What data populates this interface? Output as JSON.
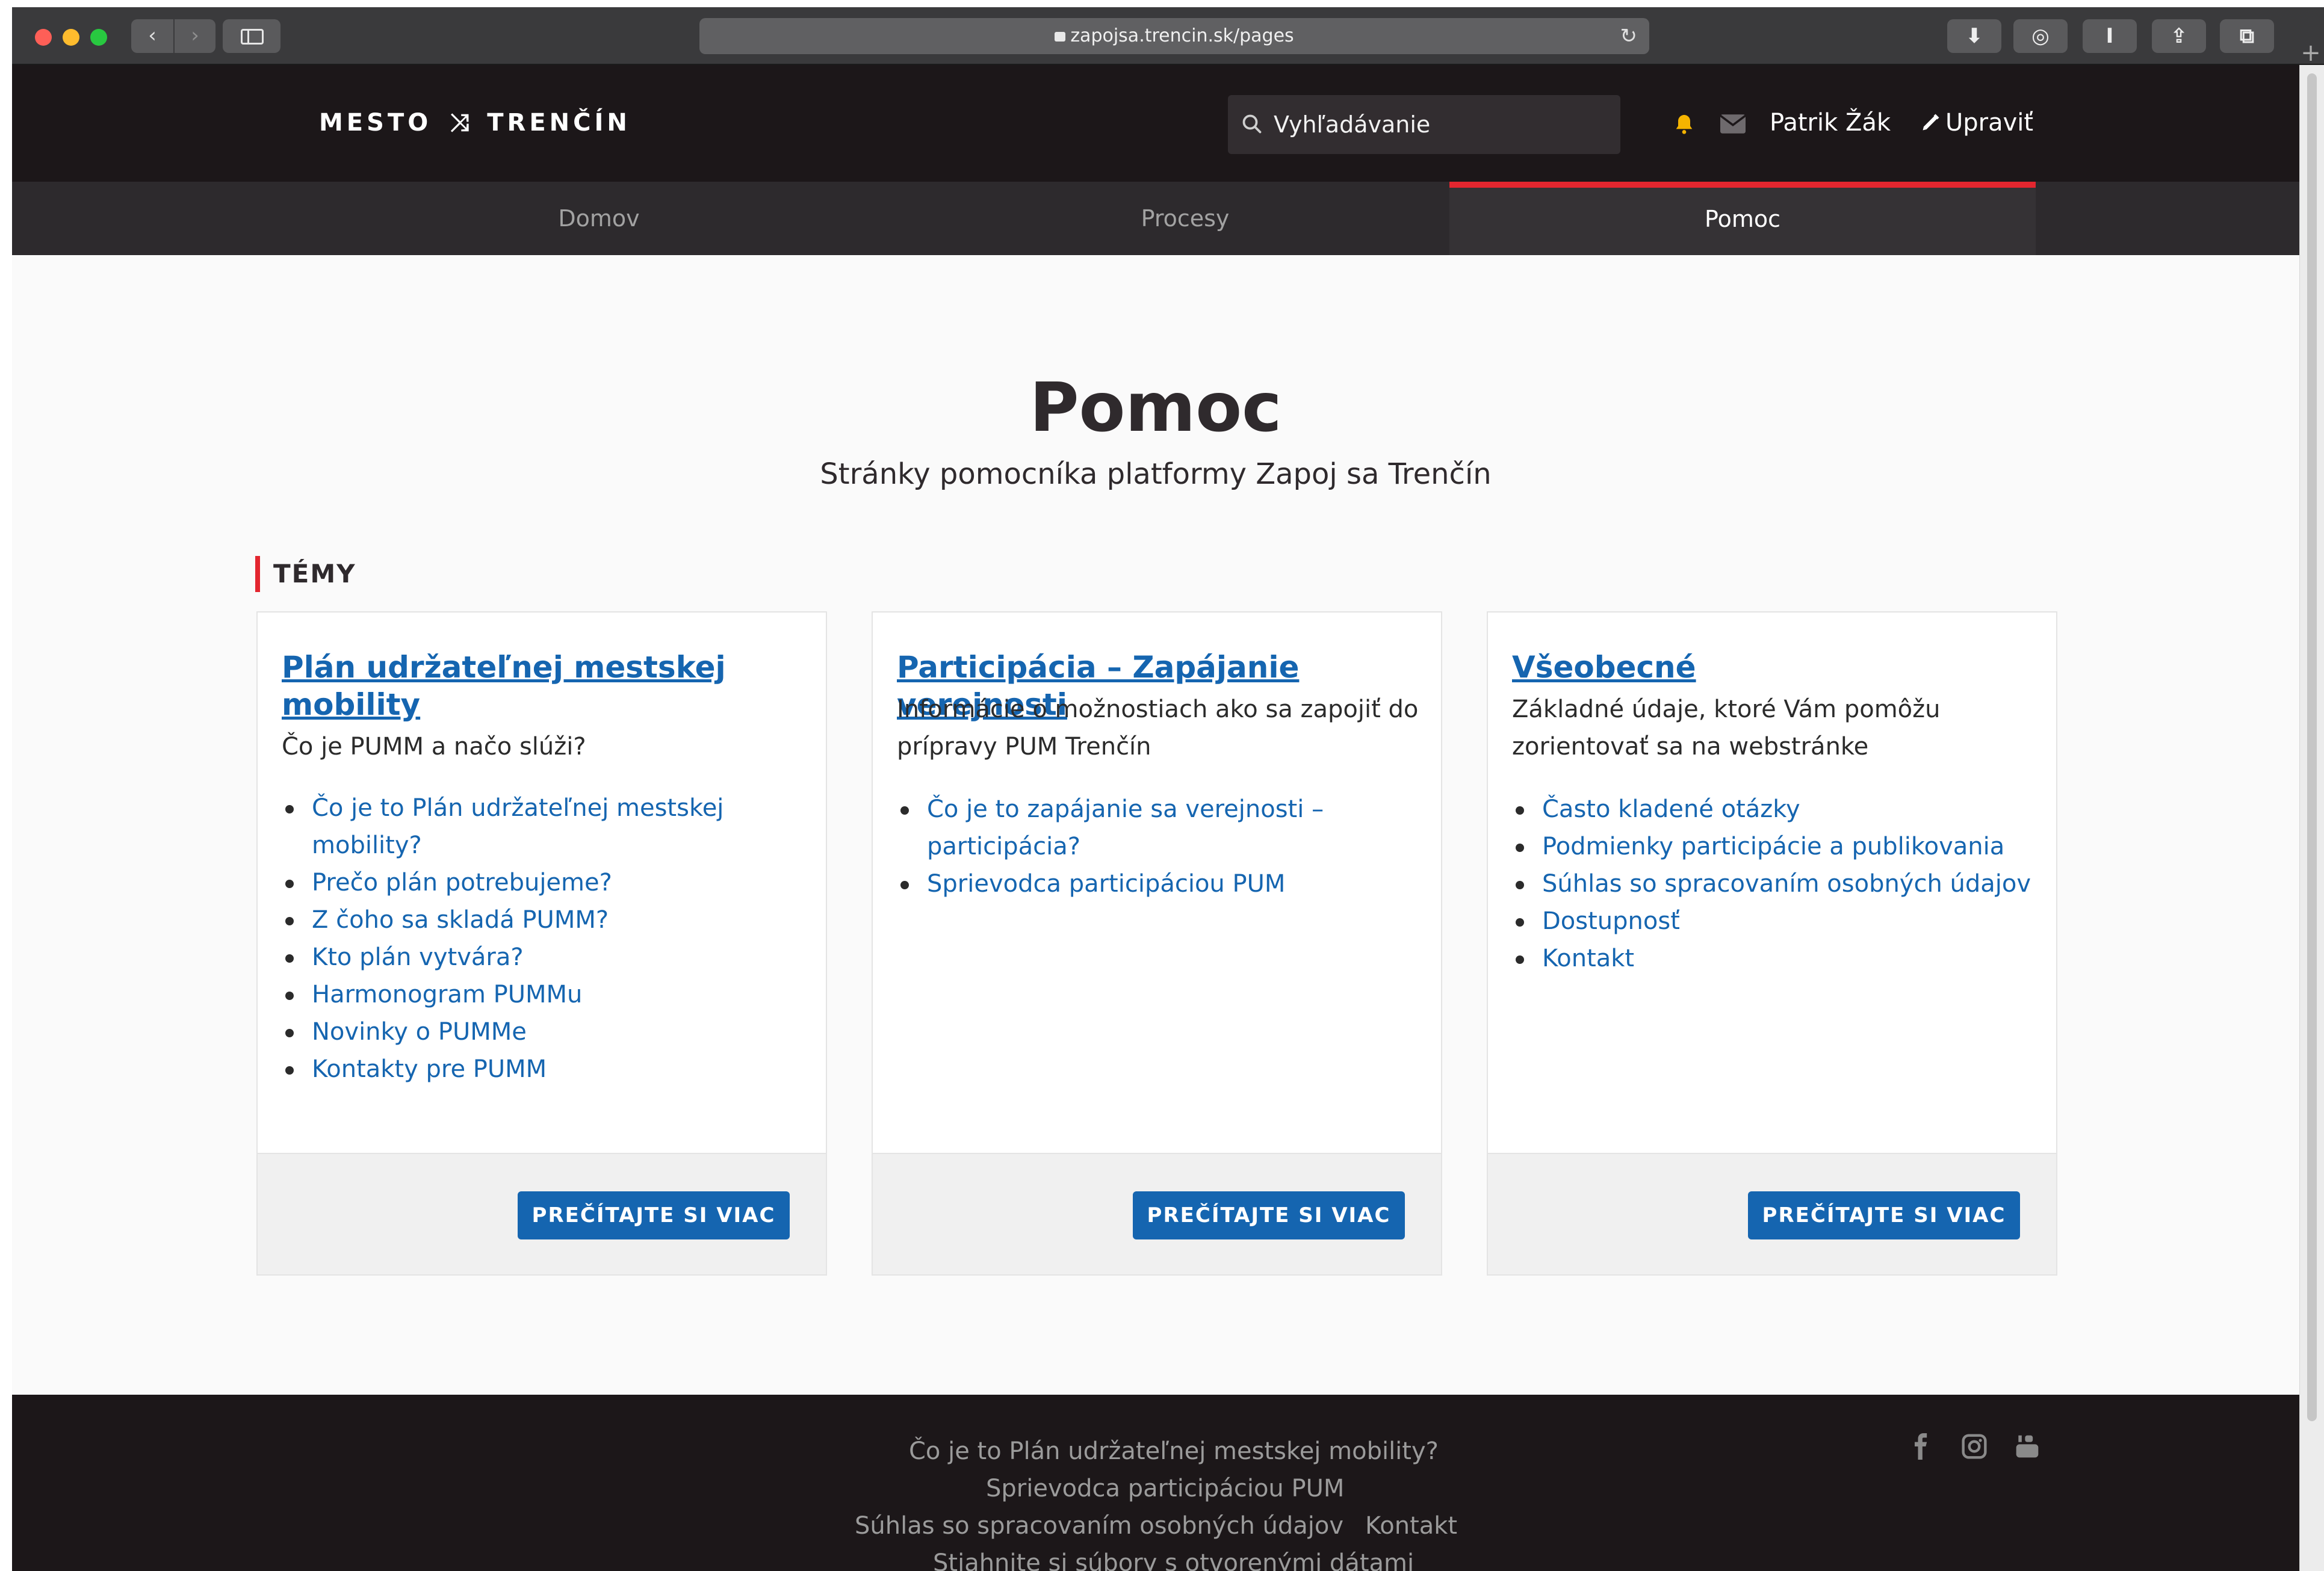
{
  "browser": {
    "url": "zapojsa.trencin.sk/pages"
  },
  "header": {
    "logo_left": "MESTO",
    "logo_right": "TRENČÍN",
    "search_placeholder": "Vyhľadávanie",
    "user_name": "Patrik Žák",
    "edit_label": "Upraviť"
  },
  "nav": {
    "items": [
      {
        "label": "Domov",
        "active": false
      },
      {
        "label": "Procesy",
        "active": false
      },
      {
        "label": "Pomoc",
        "active": true
      }
    ]
  },
  "main": {
    "title": "Pomoc",
    "subtitle": "Stránky pomocníka platformy Zapoj sa Trenčín",
    "section_label": "TÉMY",
    "cards": [
      {
        "title": "Plán udržateľnej mestskej mobility",
        "description": "Čo je PUMM a načo slúži?",
        "links": [
          "Čo je to Plán udržateľnej mestskej mobility?",
          "Prečo plán potrebujeme?",
          "Z čoho sa skladá PUMM?",
          "Kto plán vytvára?",
          "Harmonogram PUMMu",
          "Novinky o PUMMe",
          "Kontakty pre PUMM"
        ],
        "button": "PREČÍTAJTE SI VIAC"
      },
      {
        "title": "Participácia – Zapájanie verejnosti",
        "description": "Informácie o možnostiach ako sa zapojiť do prípravy PUM Trenčín",
        "links": [
          "Čo je to zapájanie sa verejnosti – participácia?",
          "Sprievodca participáciou PUM"
        ],
        "button": "PREČÍTAJTE SI VIAC"
      },
      {
        "title": "Všeobecné",
        "description": "Základné údaje, ktoré Vám pomôžu zorientovať sa na webstránke",
        "links": [
          "Často kladené otázky",
          "Podmienky participácie a publikovania",
          "Súhlas so spracovaním osobných údajov",
          "Dostupnosť",
          "Kontakt"
        ],
        "button": "PREČÍTAJTE SI VIAC"
      }
    ]
  },
  "footer": {
    "links": [
      "Čo je to Plán udržateľnej mestskej mobility?",
      "Sprievodca participáciou PUM",
      "Súhlas so spracovaním osobných údajov",
      "Kontakt",
      "Stiahnite si súbory s otvorenými dátami"
    ],
    "social_icons": [
      "facebook-icon",
      "instagram-icon",
      "youtube-icon"
    ]
  },
  "colors": {
    "accent_red": "#e3262f",
    "link_blue": "#1565b0",
    "header_dark": "#1c1719",
    "bell_yellow": "#f5b400"
  }
}
